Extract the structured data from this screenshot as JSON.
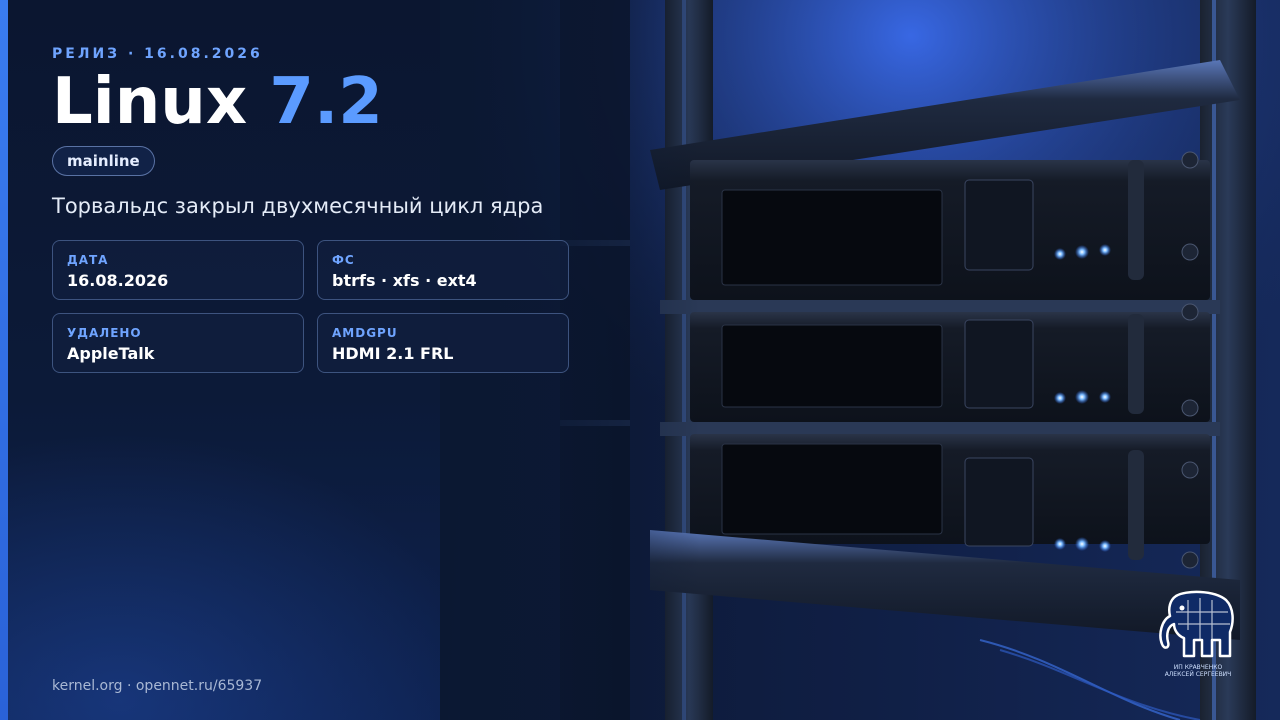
{
  "slide": {
    "kicker": "РЕЛИЗ · 16.08.2026",
    "title_main": "Linux",
    "title_version": "7.2",
    "tag": "mainline",
    "subtitle": "Торвальдс закрыл двухмесячный цикл ядра",
    "cards": [
      {
        "label": "ДАТА",
        "value": "16.08.2026"
      },
      {
        "label": "ФС",
        "value": "btrfs · xfs · ext4"
      },
      {
        "label": "УДАЛЕНО",
        "value": "AppleTalk"
      },
      {
        "label": "AMDGPU",
        "value": "HDMI 2.1 FRL"
      }
    ],
    "footer": "kernel.org · opennet.ru/65937",
    "logo": {
      "icon": "elephant-icon",
      "line1": "ИП КРАВЧЕНКО",
      "line2": "АЛЕКСЕЙ СЕРГЕЕВИЧ"
    }
  },
  "colors": {
    "accent": "#5b9bff",
    "accent_bar": "#3a7cf0",
    "background": "#0b1630",
    "led": "#6fb2ff"
  }
}
